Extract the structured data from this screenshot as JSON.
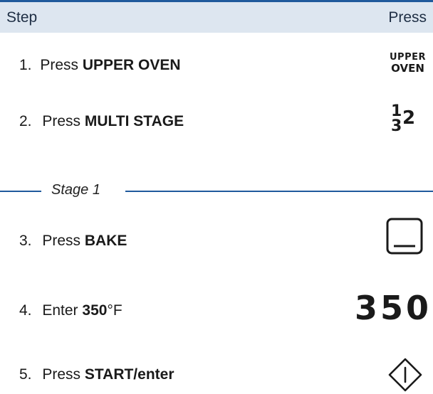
{
  "header": {
    "step_label": "Step",
    "press_label": "Press"
  },
  "steps": [
    {
      "number": "1.",
      "prefix": "Press ",
      "bold": "UPPER OVEN",
      "suffix": ""
    },
    {
      "number": "2.",
      "prefix": "Press ",
      "bold": "MULTI STAGE",
      "suffix": ""
    },
    {
      "number": "3.",
      "prefix": "Press ",
      "bold": "BAKE",
      "suffix": ""
    },
    {
      "number": "4.",
      "prefix": "Enter ",
      "bold": "350",
      "suffix": "°F"
    },
    {
      "number": "5.",
      "prefix": "Press ",
      "bold": "START/enter",
      "suffix": ""
    }
  ],
  "stage": {
    "label": "Stage 1"
  },
  "keys": {
    "upper_oven_line1": "UPPER",
    "upper_oven_line2": "OVEN",
    "multi_stage_1": "1",
    "multi_stage_2": "2",
    "multi_stage_3": "3",
    "temperature": "350"
  },
  "colors": {
    "accent": "#1f5a9c",
    "header_bg": "#dde6f0"
  },
  "icons": {
    "bake": "bake-square-icon",
    "start": "start-diamond-icon"
  }
}
